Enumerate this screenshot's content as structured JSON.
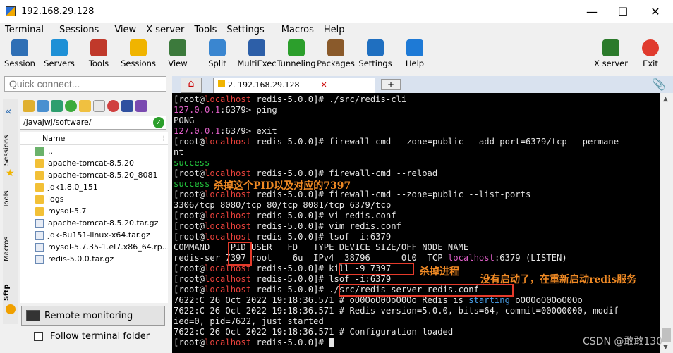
{
  "window": {
    "title": "192.168.29.128",
    "controls": [
      "—",
      "☐",
      "✕"
    ]
  },
  "menu": [
    "Terminal",
    "Sessions",
    "View",
    "X server",
    "Tools",
    "Settings",
    "Macros",
    "Help"
  ],
  "toolbar": [
    {
      "label": "Session",
      "icon": "session-icon",
      "color": "#2f6fb5"
    },
    {
      "label": "Servers",
      "icon": "servers-icon",
      "color": "#1e90d6"
    },
    {
      "label": "Tools",
      "icon": "tools-icon",
      "color": "#c0392b"
    },
    {
      "label": "Sessions",
      "icon": "star-icon",
      "color": "#f0b400"
    },
    {
      "label": "View",
      "icon": "view-icon",
      "color": "#3c7a3c"
    },
    {
      "label": "Split",
      "icon": "split-icon",
      "color": "#3a86d0"
    },
    {
      "label": "MultiExec",
      "icon": "multiexec-icon",
      "color": "#2d5fa8"
    },
    {
      "label": "Tunneling",
      "icon": "tunneling-icon",
      "color": "#2c9f2c"
    },
    {
      "label": "Packages",
      "icon": "packages-icon",
      "color": "#8a5a2b"
    },
    {
      "label": "Settings",
      "icon": "settings-icon",
      "color": "#1f6fc0"
    },
    {
      "label": "Help",
      "icon": "help-icon",
      "color": "#1e7ad6"
    }
  ],
  "toolbar_right": [
    {
      "label": "X server",
      "icon": "x-server-icon",
      "color": "#2b7a2b"
    },
    {
      "label": "Exit",
      "icon": "exit-icon",
      "color": "#e03b2e"
    }
  ],
  "quick_connect": {
    "placeholder": "Quick connect..."
  },
  "tabs": {
    "home_icon": "home-icon",
    "session_tab": "2. 192.168.29.128"
  },
  "sidebar_tabs": [
    "Sessions",
    "Tools",
    "Macros",
    "Sftp"
  ],
  "file_browser": {
    "path": "/javajwj/software/",
    "column": "Name",
    "items": [
      {
        "name": "..",
        "type": "updir"
      },
      {
        "name": "apache-tomcat-8.5.20",
        "type": "folder"
      },
      {
        "name": "apache-tomcat-8.5.20_8081",
        "type": "folder"
      },
      {
        "name": "jdk1.8.0_151",
        "type": "folder"
      },
      {
        "name": "logs",
        "type": "folder"
      },
      {
        "name": "mysql-5.7",
        "type": "folder"
      },
      {
        "name": "apache-tomcat-8.5.20.tar.gz",
        "type": "archive"
      },
      {
        "name": "jdk-8u151-linux-x64.tar.gz",
        "type": "archive"
      },
      {
        "name": "mysql-5.7.35-1.el7.x86_64.rp...",
        "type": "archive"
      },
      {
        "name": "redis-5.0.0.tar.gz",
        "type": "archive"
      }
    ],
    "remote_monitoring": "Remote monitoring",
    "follow_terminal": "Follow terminal folder"
  },
  "terminal": {
    "lines": [
      [
        [
          "[root@",
          "w"
        ],
        [
          "localhost",
          "r"
        ],
        [
          " redis-5.0.0]# ./src/redis-cli",
          "w"
        ]
      ],
      [
        [
          "127.0.0.1",
          "p"
        ],
        [
          ":6379> ping",
          "w"
        ]
      ],
      [
        [
          "PONG",
          "w"
        ]
      ],
      [
        [
          "127.0.0.1",
          "p"
        ],
        [
          ":6379> exit",
          "w"
        ]
      ],
      [
        [
          "[root@",
          "w"
        ],
        [
          "localhost",
          "r"
        ],
        [
          " redis-5.0.0]# firewall-cmd --zone=public --add-port=6379/tcp --permane",
          "w"
        ]
      ],
      [
        [
          "nt",
          "w"
        ]
      ],
      [
        [
          "success",
          "g"
        ]
      ],
      [
        [
          "[root@",
          "w"
        ],
        [
          "localhost",
          "r"
        ],
        [
          " redis-5.0.0]# firewall-cmd --reload",
          "w"
        ]
      ],
      [
        [
          "success",
          "g"
        ]
      ],
      [
        [
          "[root@",
          "w"
        ],
        [
          "localhost",
          "r"
        ],
        [
          " redis-5.0.0]# firewall-cmd --zone=public --list-ports",
          "w"
        ]
      ],
      [
        [
          "3306/tcp 8080/tcp 80/tcp 8081/tcp 6379/tcp",
          "w"
        ]
      ],
      [
        [
          "[root@",
          "w"
        ],
        [
          "localhost",
          "r"
        ],
        [
          " redis-5.0.0]# vi redis.conf",
          "w"
        ]
      ],
      [
        [
          "[root@",
          "w"
        ],
        [
          "localhost",
          "r"
        ],
        [
          " redis-5.0.0]# vim redis.conf",
          "w"
        ]
      ],
      [
        [
          "[root@",
          "w"
        ],
        [
          "localhost",
          "r"
        ],
        [
          " redis-5.0.0]# lsof -i:6379",
          "w"
        ]
      ],
      [
        [
          "COMMAND    PID USER   FD   TYPE DEVICE SIZE/OFF NODE NAME",
          "w"
        ]
      ],
      [
        [
          "redis-ser 7397 root    6u  IPv4  38796      0t0  TCP ",
          "w"
        ],
        [
          "localhost",
          "p"
        ],
        [
          ":6379 (LISTEN)",
          "w"
        ]
      ],
      [
        [
          "[root@",
          "w"
        ],
        [
          "localhost",
          "r"
        ],
        [
          " redis-5.0.0]# kill -9 7397",
          "w"
        ]
      ],
      [
        [
          "[root@",
          "w"
        ],
        [
          "localhost",
          "r"
        ],
        [
          " redis-5.0.0]# lsof -i:6379",
          "w"
        ]
      ],
      [
        [
          "[root@",
          "w"
        ],
        [
          "localhost",
          "r"
        ],
        [
          " redis-5.0.0]# ./src/redis-server redis.conf",
          "w"
        ]
      ],
      [
        [
          "7622:C 26 Oct 2022 19:18:36.571 # oO0OoO0OoO0Oo Redis is ",
          "w"
        ],
        [
          "starting",
          "b"
        ],
        [
          " oO0OoO0OoO0Oo",
          "w"
        ]
      ],
      [
        [
          "7622:C 26 Oct 2022 19:18:36.571 # Redis version=5.0.0, bits=64, commit=00000000, modif",
          "w"
        ]
      ],
      [
        [
          "ied=0, pid=7622, just started",
          "w"
        ]
      ],
      [
        [
          "7622:C 26 Oct 2022 19:18:36.571 # Configuration loaded",
          "w"
        ]
      ],
      [
        [
          "[root@",
          "w"
        ],
        [
          "localhost",
          "r"
        ],
        [
          " redis-5.0.0]# ",
          "w"
        ]
      ]
    ]
  },
  "annotations": {
    "kill_pid_note": "杀掉这个PID以及对应的7397",
    "kill_process_note": "杀掉进程",
    "restart_note": "没有启动了，在重新启动redis服务"
  },
  "watermark": "CSDN @敢敢130"
}
